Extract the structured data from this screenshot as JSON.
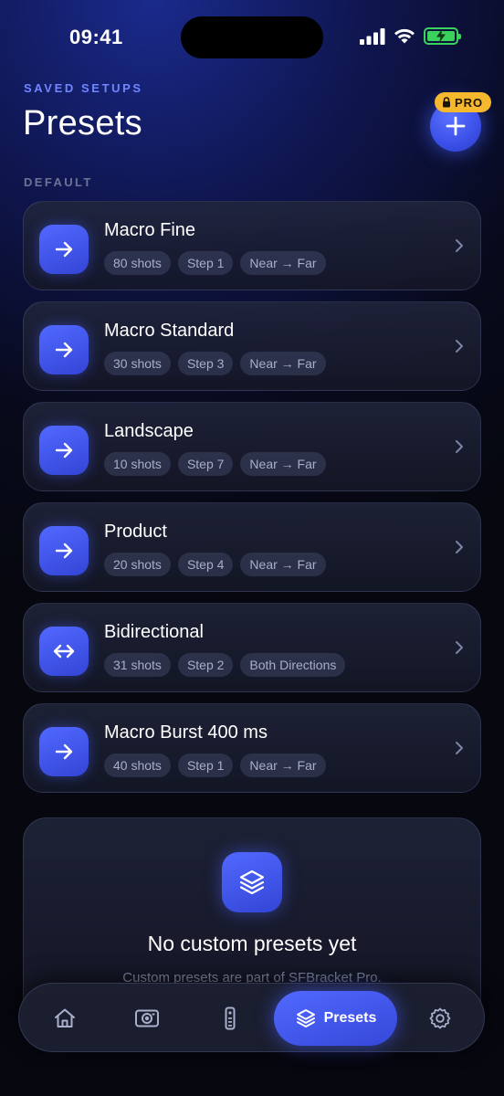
{
  "status_bar": {
    "time": "09:41"
  },
  "header": {
    "eyebrow": "SAVED SETUPS",
    "title": "Presets",
    "pro_badge": "PRO"
  },
  "section_label": "DEFAULT",
  "presets": [
    {
      "name": "Macro Fine",
      "shots": "80 shots",
      "step": "Step 1",
      "direction": "Near → Far",
      "icon": "arrow-right-icon"
    },
    {
      "name": "Macro Standard",
      "shots": "30 shots",
      "step": "Step 3",
      "direction": "Near → Far",
      "icon": "arrow-right-icon"
    },
    {
      "name": "Landscape",
      "shots": "10 shots",
      "step": "Step 7",
      "direction": "Near → Far",
      "icon": "arrow-right-icon"
    },
    {
      "name": "Product",
      "shots": "20 shots",
      "step": "Step 4",
      "direction": "Near → Far",
      "icon": "arrow-right-icon"
    },
    {
      "name": "Bidirectional",
      "shots": "31 shots",
      "step": "Step 2",
      "direction": "Both Directions",
      "icon": "arrows-left-right-icon"
    },
    {
      "name": "Macro Burst 400 ms",
      "shots": "40 shots",
      "step": "Step 1",
      "direction": "Near → Far",
      "icon": "arrow-right-icon"
    }
  ],
  "empty_state": {
    "title": "No custom presets yet",
    "subtitle": "Custom presets are part of SFBracket Pro."
  },
  "tab_bar": {
    "tabs": [
      {
        "name": "home",
        "icon": "home-icon"
      },
      {
        "name": "camera",
        "icon": "camera-icon"
      },
      {
        "name": "remote",
        "icon": "remote-icon"
      },
      {
        "name": "presets",
        "icon": "layers-icon",
        "label": "Presets",
        "active": true
      },
      {
        "name": "settings",
        "icon": "gear-icon"
      }
    ]
  },
  "colors": {
    "accent": "#4a60f5",
    "pro": "#f5b82e",
    "battery": "#3ad15c"
  }
}
